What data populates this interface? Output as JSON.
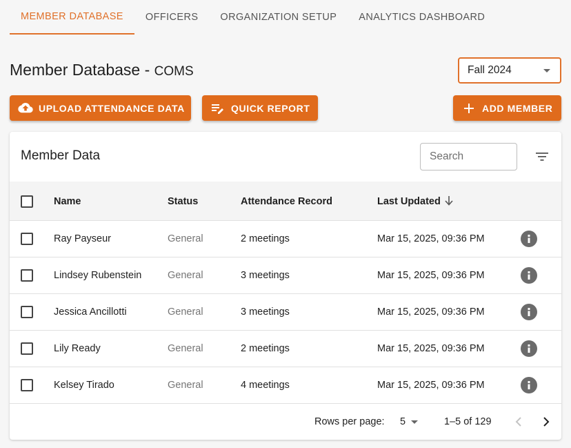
{
  "tabs": [
    {
      "label": "Member Database",
      "active": true
    },
    {
      "label": "Officers",
      "active": false
    },
    {
      "label": "Organization Setup",
      "active": false
    },
    {
      "label": "Analytics Dashboard",
      "active": false
    }
  ],
  "header": {
    "title": "Member Database - ",
    "org": "COMS",
    "semester": "Fall 2024"
  },
  "toolbar": {
    "upload_label": "Upload Attendance Data",
    "report_label": "Quick Report",
    "add_label": "Add Member"
  },
  "table": {
    "title": "Member Data",
    "search_placeholder": "Search",
    "columns": [
      "Name",
      "Status",
      "Attendance Record",
      "Last Updated"
    ],
    "sort_column": "Last Updated",
    "sort_direction": "desc",
    "rows": [
      {
        "name": "Ray Payseur",
        "status": "General",
        "attendance": "2 meetings",
        "updated": "Mar 15, 2025, 09:36 PM"
      },
      {
        "name": "Lindsey Rubenstein",
        "status": "General",
        "attendance": "3 meetings",
        "updated": "Mar 15, 2025, 09:36 PM"
      },
      {
        "name": "Jessica Ancillotti",
        "status": "General",
        "attendance": "3 meetings",
        "updated": "Mar 15, 2025, 09:36 PM"
      },
      {
        "name": "Lily Ready",
        "status": "General",
        "attendance": "2 meetings",
        "updated": "Mar 15, 2025, 09:36 PM"
      },
      {
        "name": "Kelsey Tirado",
        "status": "General",
        "attendance": "4 meetings",
        "updated": "Mar 15, 2025, 09:36 PM"
      }
    ]
  },
  "pagination": {
    "rows_per_page_label": "Rows per page:",
    "rows_per_page": "5",
    "range": "1–5 of 129"
  },
  "colors": {
    "accent": "#e06b1c",
    "tab_active": "#e0712a",
    "info_icon": "#6b6b6b"
  },
  "icons": [
    "cloud-upload-icon",
    "edit-note-icon",
    "plus-icon",
    "filter-icon",
    "sort-arrow-down-icon",
    "info-icon",
    "chevron-left-icon",
    "chevron-right-icon",
    "caret-down-icon"
  ]
}
